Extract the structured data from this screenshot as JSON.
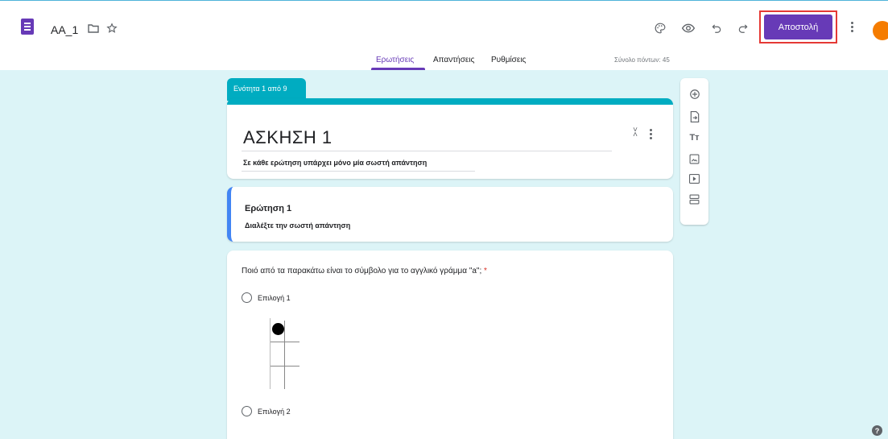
{
  "header": {
    "doc_title": "AA_1",
    "send_label": "Αποστολή",
    "icons": [
      "forms-app-icon",
      "folder-icon",
      "star-icon",
      "palette-icon",
      "preview-eye-icon",
      "undo-icon",
      "redo-icon",
      "more-vert-icon",
      "avatar"
    ]
  },
  "tabs": {
    "items": [
      {
        "label": "Ερωτήσεις",
        "active": true
      },
      {
        "label": "Απαντήσεις",
        "active": false
      },
      {
        "label": "Ρυθμίσεις",
        "active": false
      }
    ],
    "points": "Σύνολο πόντων: 45"
  },
  "section": {
    "tab_label": "Ενότητα 1 από 9",
    "title": "ΑΣΚΗΣΗ 1",
    "description": "Σε κάθε ερώτηση υπάρχει μόνο μία σωστή απάντηση"
  },
  "question_header": {
    "title": "Ερώτηση 1",
    "description": "Διαλέξτε την σωστή απάντηση"
  },
  "question": {
    "text": "Ποιό από τα παρακάτω είναι το σύμβολο για το αγγλικό γράμμα \"a\";",
    "required_mark": "*",
    "options": [
      {
        "label": "Επιλογή 1"
      },
      {
        "label": "Επιλογή 2"
      }
    ]
  },
  "side_toolbar": [
    "add-question-icon",
    "import-questions-icon",
    "add-title-icon",
    "add-image-icon",
    "add-video-icon",
    "add-section-icon"
  ],
  "colors": {
    "accent": "#673ab7",
    "section": "#00acc1",
    "background": "#dcf4f7",
    "question_border": "#4285f4"
  }
}
